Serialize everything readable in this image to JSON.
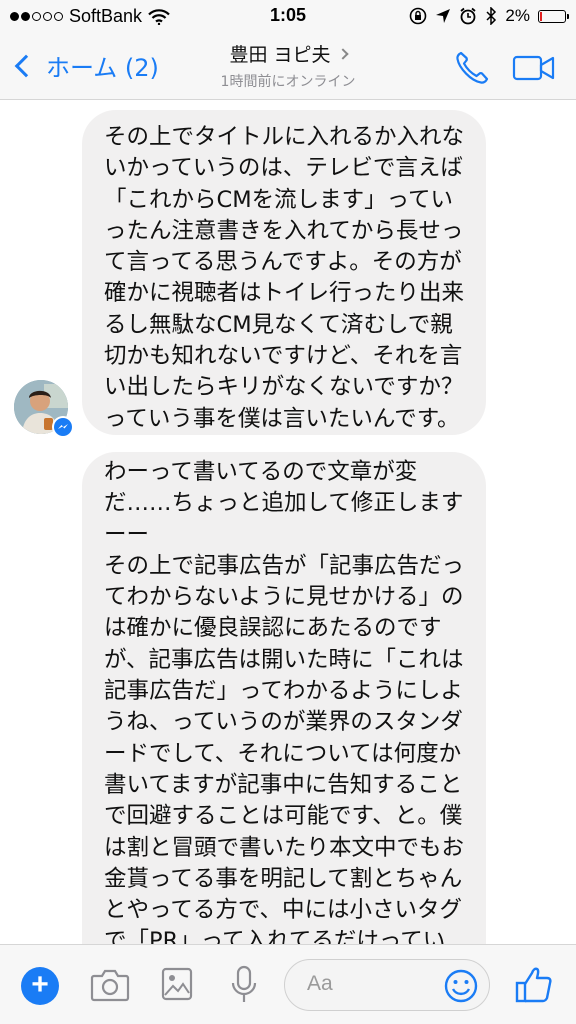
{
  "status_bar": {
    "carrier": "SoftBank",
    "time": "1:05",
    "battery_percent": "2%",
    "battery_level": 0.02
  },
  "nav": {
    "back_label": "ホーム (2)",
    "title": "豊田 ヨピ夫",
    "subtitle": "1時間前にオンライン"
  },
  "messages": [
    {
      "text": "その上でタイトルに入れるか入れな\nいかっていうのは、テレビで言えば\n「これからCMを流します」ってい\nったん注意書きを入れてから長せっ\nて言ってる思うんですよ。その方が\n確かに視聴者はトイレ行ったり出来\nるし無駄なCM見なくて済むしで親\n切かも知れないですけど、それを言\nい出したらキリがなくないですか？\nっていう事を僕は言いたいんです。"
    },
    {
      "text": "わーって書いてるので文章が変\nだ……ちょっと追加して修正します\nーー\nその上で記事広告が「記事広告だっ\nてわからないように見せかける」の\nは確かに優良誤認にあたるのです\nが、記事広告は開いた時に「これは\n記事広告だ」ってわかるようにしよ\nうね、っていうのが業界のスタンダ\nードでして、それについては何度か\n書いてますが記事中に告知すること\nで回避することは可能です、と。僕\nは割と冒頭で書いたり本文中でもお\n金貰ってる事を明記して割とちゃん\nとやってる方で、中には小さいタグ\nで「PR」って入れてるだけってい"
    }
  ],
  "composer": {
    "placeholder": "Aa"
  },
  "colors": {
    "accent": "#1a7cf5",
    "bubble": "#f1f0f0",
    "bar_background": "#f7f7f7"
  },
  "icons": [
    "wifi-icon",
    "lock-rotation-icon",
    "location-arrow-icon",
    "alarm-icon",
    "bluetooth-icon",
    "battery-icon",
    "back-chevron-icon",
    "phone-icon",
    "video-camera-icon",
    "messenger-icon",
    "plus-icon",
    "camera-icon",
    "photo-icon",
    "microphone-icon",
    "emoji-icon",
    "thumbs-up-icon"
  ]
}
